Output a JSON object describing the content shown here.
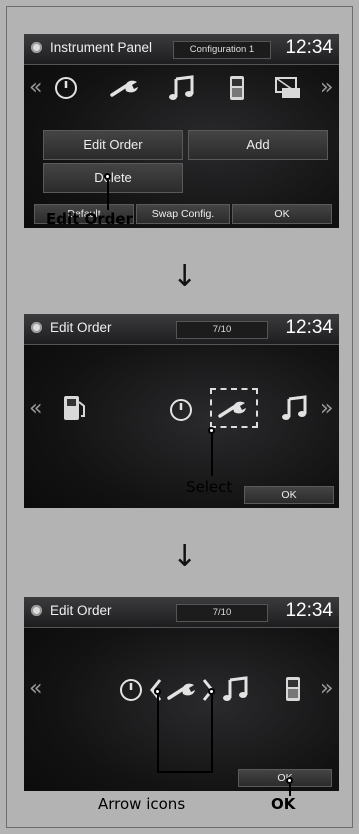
{
  "screen1": {
    "title": "Instrument Panel",
    "config": "Configuration 1",
    "time": "12:34",
    "left_arrow": "«",
    "right_arrow": "»",
    "buttons": {
      "edit_order": "Edit Order",
      "add": "Add",
      "delete": "Delete",
      "default": "Default",
      "swap": "Swap Config.",
      "ok": "OK"
    }
  },
  "callout1": "Edit Order",
  "screen2": {
    "title": "Edit Order",
    "page": "7/10",
    "time": "12:34",
    "left_arrow": "«",
    "right_arrow": "»",
    "ok": "OK"
  },
  "callout2": "Select",
  "screen3": {
    "title": "Edit Order",
    "page": "7/10",
    "time": "12:34",
    "left_arrow": "«",
    "right_arrow": "»",
    "ok": "OK"
  },
  "callout3_arrows": "Arrow icons",
  "callout3_ok": "OK",
  "down_arrow": "↓",
  "colors": {
    "background": "#b3b3b3",
    "screen": "#121213"
  }
}
